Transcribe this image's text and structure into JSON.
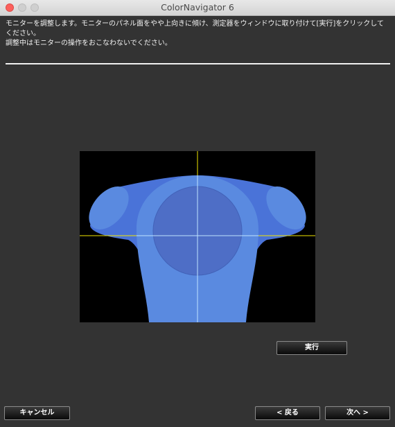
{
  "window": {
    "title": "ColorNavigator 6"
  },
  "instructions": {
    "line1": "モニターを調整します。モニターのパネル面をやや上向きに傾け、測定器をウィンドウに取り付けて[実行]をクリックしてください。",
    "line2": "調整中はモニターの操作をおこなわないでください。"
  },
  "preview": {
    "crosshair_color": "#f2e600",
    "crosshair_inner_color": "#bfe3ff",
    "device_color": "#4a73d8",
    "device_ring_color": "#5a8ae0",
    "lens_color": "#4e6ec6"
  },
  "buttons": {
    "execute": "実行",
    "cancel": "キャンセル",
    "back": "< 戻る",
    "next": "次へ >"
  }
}
